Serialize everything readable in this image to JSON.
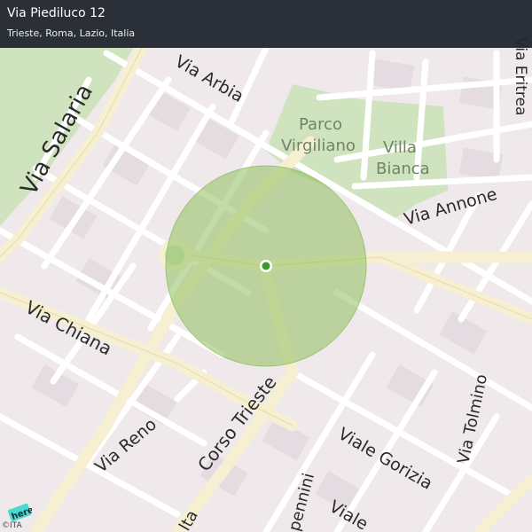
{
  "header": {
    "title": "Via Piediluco 12",
    "subtitle": "Trieste, Roma, Lazio, Italia"
  },
  "map": {
    "labels": {
      "via_salaria": "Via Salaria",
      "via_arbia": "Via Arbia",
      "parco_line1": "Parco",
      "parco_line2": "Virgiliano",
      "villa_line1": "Villa",
      "villa_line2": "Bianca",
      "via_annone": "Via Annone",
      "via_chiana": "Via Chiana",
      "via_reno": "Via Reno",
      "corso_trieste": "Corso Trieste",
      "viale_gorizia": "Viale Gorizia",
      "via_tolmino": "Via Tolmino",
      "viale_partial": "Viale",
      "appennini_partial": "pennini",
      "alta_partial": "lta",
      "top_right_partial": "Via Eritrea"
    },
    "colors": {
      "background": "#efe9ec",
      "road_major": "#f6efd2",
      "road_minor": "#ffffff",
      "park": "#cfe3bf",
      "accuracy_circle": "#8fbf5e",
      "location_dot": "#3a9a2a"
    }
  },
  "footer": {
    "logo_text": "here",
    "attribution": "©ITA"
  }
}
